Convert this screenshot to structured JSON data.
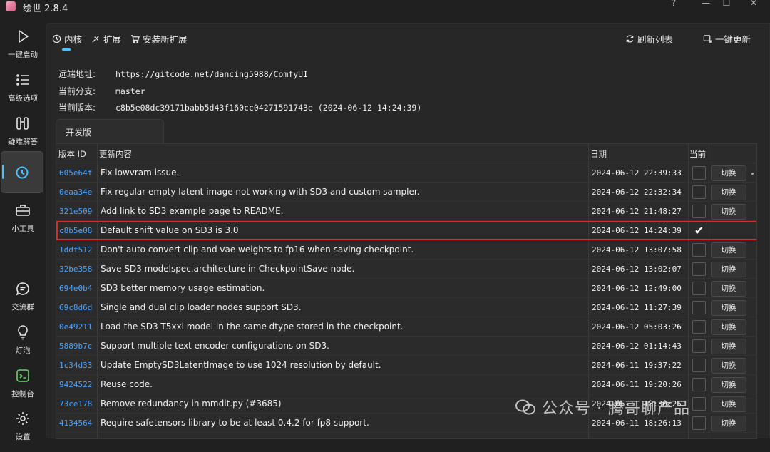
{
  "app": {
    "title": "绘世 2.8.4",
    "help": "?",
    "minimize": "—",
    "maximize": "☐",
    "close": "✕"
  },
  "sidebar": {
    "items": [
      {
        "label": "一键启动",
        "icon": "play-icon"
      },
      {
        "label": "高级选项",
        "icon": "list-icon"
      },
      {
        "label": "疑难解答",
        "icon": "tools-icon"
      },
      {
        "label": "",
        "icon": "history-icon"
      },
      {
        "label": "小工具",
        "icon": "toolbox-icon"
      },
      {
        "label": "交流群",
        "icon": "chat-icon"
      },
      {
        "label": "灯泡",
        "icon": "bulb-icon"
      },
      {
        "label": "控制台",
        "icon": "console-icon"
      },
      {
        "label": "设置",
        "icon": "gear-icon"
      }
    ]
  },
  "tabs": {
    "kernel": "内核",
    "extensions": "扩展",
    "install": "安装新扩展",
    "refresh": "刷新列表",
    "update_all": "一键更新"
  },
  "info": {
    "remote_label": "远端地址:",
    "remote_value": "https://gitcode.net/dancing5988/ComfyUI",
    "branch_label": "当前分支:",
    "branch_value": "master",
    "version_label": "当前版本:",
    "version_value": "c8b5e08dc39171babb5d43f160cc04271591743e (2024-06-12 14:24:39)"
  },
  "branch_tab": "开发版",
  "table": {
    "headers": {
      "id": "版本 ID",
      "msg": "更新内容",
      "date": "日期",
      "current": "当前"
    },
    "switch_label": "切换",
    "rows": [
      {
        "id": "605e64f",
        "msg": "Fix lowvram issue.",
        "date": "2024-06-12 22:39:33",
        "current": false
      },
      {
        "id": "0eaa34e",
        "msg": "Fix regular empty latent image not working with SD3 and custom sampler.",
        "date": "2024-06-12 22:32:34",
        "current": false
      },
      {
        "id": "321e509",
        "msg": "Add link to SD3 example page to README.",
        "date": "2024-06-12 21:48:27",
        "current": false
      },
      {
        "id": "c8b5e08",
        "msg": "Default shift value on SD3 is 3.0",
        "date": "2024-06-12 14:24:39",
        "current": true
      },
      {
        "id": "1ddf512",
        "msg": "Don't auto convert clip and vae weights to fp16 when saving checkpoint.",
        "date": "2024-06-12 13:07:58",
        "current": false
      },
      {
        "id": "32be358",
        "msg": "Save SD3 modelspec.architecture in CheckpointSave node.",
        "date": "2024-06-12 13:02:07",
        "current": false
      },
      {
        "id": "694e0b4",
        "msg": "SD3 better memory usage estimation.",
        "date": "2024-06-12 12:49:00",
        "current": false
      },
      {
        "id": "69c8d6d",
        "msg": "Single and dual clip loader nodes support SD3.",
        "date": "2024-06-12 11:27:39",
        "current": false
      },
      {
        "id": "0e49211",
        "msg": "Load the SD3 T5xxl model in the same dtype stored in the checkpoint.",
        "date": "2024-06-12 05:03:26",
        "current": false
      },
      {
        "id": "5889b7c",
        "msg": "Support multiple text encoder configurations on SD3.",
        "date": "2024-06-12 01:14:43",
        "current": false
      },
      {
        "id": "1c34d33",
        "msg": "Update EmptySD3LatentImage to use 1024 resolution by default.",
        "date": "2024-06-11 19:37:22",
        "current": false
      },
      {
        "id": "9424522",
        "msg": "Reuse code.",
        "date": "2024-06-11 19:20:26",
        "current": false
      },
      {
        "id": "73ce178",
        "msg": "Remove redundancy in mmdit.py (#3685)",
        "date": "2024-06-11 18:30:25",
        "current": false
      },
      {
        "id": "4134564",
        "msg": "Require safetensors library to be at least 0.4.2 for fp8 support.",
        "date": "2024-06-11 18:26:13",
        "current": false
      }
    ]
  },
  "watermark": "公众号 · 腾哥聊产品"
}
